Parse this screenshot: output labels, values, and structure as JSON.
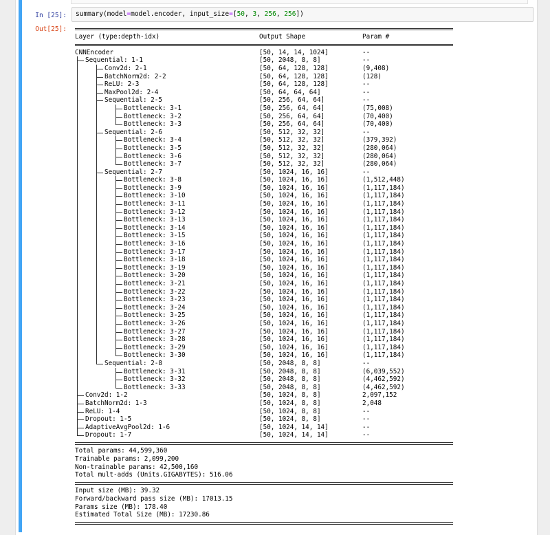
{
  "input_prompt": "In [25]:",
  "output_prompt": "Out[25]:",
  "input_code": {
    "prefix": "summary(model",
    "op1": "=",
    "mid": "model.encoder, input_size",
    "op2": "=",
    "open": "[",
    "n1": "50",
    "sep1": ", ",
    "n2": "3",
    "sep2": ", ",
    "n3": "256",
    "sep3": ", ",
    "n4": "256",
    "close": "])"
  },
  "header": {
    "layer": "Layer (type:depth-idx)",
    "shape": "Output Shape",
    "param": "Param #"
  },
  "rows": [
    {
      "label": "CNNEncoder",
      "shape": "[50, 14, 14, 1024]",
      "param": "--"
    },
    {
      "label": "Sequential: 1-1",
      "shape": "[50, 2048, 8, 8]",
      "param": "--"
    },
    {
      "label": "Conv2d: 2-1",
      "shape": "[50, 64, 128, 128]",
      "param": "(9,408)"
    },
    {
      "label": "BatchNorm2d: 2-2",
      "shape": "[50, 64, 128, 128]",
      "param": "(128)"
    },
    {
      "label": "ReLU: 2-3",
      "shape": "[50, 64, 128, 128]",
      "param": "--"
    },
    {
      "label": "MaxPool2d: 2-4",
      "shape": "[50, 64, 64, 64]",
      "param": "--"
    },
    {
      "label": "Sequential: 2-5",
      "shape": "[50, 256, 64, 64]",
      "param": "--"
    },
    {
      "label": "Bottleneck: 3-1",
      "shape": "[50, 256, 64, 64]",
      "param": "(75,008)"
    },
    {
      "label": "Bottleneck: 3-2",
      "shape": "[50, 256, 64, 64]",
      "param": "(70,400)"
    },
    {
      "label": "Bottleneck: 3-3",
      "shape": "[50, 256, 64, 64]",
      "param": "(70,400)"
    },
    {
      "label": "Sequential: 2-6",
      "shape": "[50, 512, 32, 32]",
      "param": "--"
    },
    {
      "label": "Bottleneck: 3-4",
      "shape": "[50, 512, 32, 32]",
      "param": "(379,392)"
    },
    {
      "label": "Bottleneck: 3-5",
      "shape": "[50, 512, 32, 32]",
      "param": "(280,064)"
    },
    {
      "label": "Bottleneck: 3-6",
      "shape": "[50, 512, 32, 32]",
      "param": "(280,064)"
    },
    {
      "label": "Bottleneck: 3-7",
      "shape": "[50, 512, 32, 32]",
      "param": "(280,064)"
    },
    {
      "label": "Sequential: 2-7",
      "shape": "[50, 1024, 16, 16]",
      "param": "--"
    },
    {
      "label": "Bottleneck: 3-8",
      "shape": "[50, 1024, 16, 16]",
      "param": "(1,512,448)"
    },
    {
      "label": "Bottleneck: 3-9",
      "shape": "[50, 1024, 16, 16]",
      "param": "(1,117,184)"
    },
    {
      "label": "Bottleneck: 3-10",
      "shape": "[50, 1024, 16, 16]",
      "param": "(1,117,184)"
    },
    {
      "label": "Bottleneck: 3-11",
      "shape": "[50, 1024, 16, 16]",
      "param": "(1,117,184)"
    },
    {
      "label": "Bottleneck: 3-12",
      "shape": "[50, 1024, 16, 16]",
      "param": "(1,117,184)"
    },
    {
      "label": "Bottleneck: 3-13",
      "shape": "[50, 1024, 16, 16]",
      "param": "(1,117,184)"
    },
    {
      "label": "Bottleneck: 3-14",
      "shape": "[50, 1024, 16, 16]",
      "param": "(1,117,184)"
    },
    {
      "label": "Bottleneck: 3-15",
      "shape": "[50, 1024, 16, 16]",
      "param": "(1,117,184)"
    },
    {
      "label": "Bottleneck: 3-16",
      "shape": "[50, 1024, 16, 16]",
      "param": "(1,117,184)"
    },
    {
      "label": "Bottleneck: 3-17",
      "shape": "[50, 1024, 16, 16]",
      "param": "(1,117,184)"
    },
    {
      "label": "Bottleneck: 3-18",
      "shape": "[50, 1024, 16, 16]",
      "param": "(1,117,184)"
    },
    {
      "label": "Bottleneck: 3-19",
      "shape": "[50, 1024, 16, 16]",
      "param": "(1,117,184)"
    },
    {
      "label": "Bottleneck: 3-20",
      "shape": "[50, 1024, 16, 16]",
      "param": "(1,117,184)"
    },
    {
      "label": "Bottleneck: 3-21",
      "shape": "[50, 1024, 16, 16]",
      "param": "(1,117,184)"
    },
    {
      "label": "Bottleneck: 3-22",
      "shape": "[50, 1024, 16, 16]",
      "param": "(1,117,184)"
    },
    {
      "label": "Bottleneck: 3-23",
      "shape": "[50, 1024, 16, 16]",
      "param": "(1,117,184)"
    },
    {
      "label": "Bottleneck: 3-24",
      "shape": "[50, 1024, 16, 16]",
      "param": "(1,117,184)"
    },
    {
      "label": "Bottleneck: 3-25",
      "shape": "[50, 1024, 16, 16]",
      "param": "(1,117,184)"
    },
    {
      "label": "Bottleneck: 3-26",
      "shape": "[50, 1024, 16, 16]",
      "param": "(1,117,184)"
    },
    {
      "label": "Bottleneck: 3-27",
      "shape": "[50, 1024, 16, 16]",
      "param": "(1,117,184)"
    },
    {
      "label": "Bottleneck: 3-28",
      "shape": "[50, 1024, 16, 16]",
      "param": "(1,117,184)"
    },
    {
      "label": "Bottleneck: 3-29",
      "shape": "[50, 1024, 16, 16]",
      "param": "(1,117,184)"
    },
    {
      "label": "Bottleneck: 3-30",
      "shape": "[50, 1024, 16, 16]",
      "param": "(1,117,184)"
    },
    {
      "label": "Sequential: 2-8",
      "shape": "[50, 2048, 8, 8]",
      "param": "--"
    },
    {
      "label": "Bottleneck: 3-31",
      "shape": "[50, 2048, 8, 8]",
      "param": "(6,039,552)"
    },
    {
      "label": "Bottleneck: 3-32",
      "shape": "[50, 2048, 8, 8]",
      "param": "(4,462,592)"
    },
    {
      "label": "Bottleneck: 3-33",
      "shape": "[50, 2048, 8, 8]",
      "param": "(4,462,592)"
    },
    {
      "label": "Conv2d: 1-2",
      "shape": "[50, 1024, 8, 8]",
      "param": "2,097,152"
    },
    {
      "label": "BatchNorm2d: 1-3",
      "shape": "[50, 1024, 8, 8]",
      "param": "2,048"
    },
    {
      "label": "ReLU: 1-4",
      "shape": "[50, 1024, 8, 8]",
      "param": "--"
    },
    {
      "label": "Dropout: 1-5",
      "shape": "[50, 1024, 8, 8]",
      "param": "--"
    },
    {
      "label": "AdaptiveAvgPool2d: 1-6",
      "shape": "[50, 1024, 14, 14]",
      "param": "--"
    },
    {
      "label": "Dropout: 1-7",
      "shape": "[50, 1024, 14, 14]",
      "param": "--"
    }
  ],
  "totals": [
    "Total params: 44,599,360",
    "Trainable params: 2,099,200",
    "Non-trainable params: 42,500,160",
    "Total mult-adds (Units.GIGABYTES): 516.06"
  ],
  "sizes": [
    "Input size (MB): 39.32",
    "Forward/backward pass size (MB): 17013.15",
    "Params size (MB): 178.40",
    "Estimated Total Size (MB): 17230.86"
  ]
}
